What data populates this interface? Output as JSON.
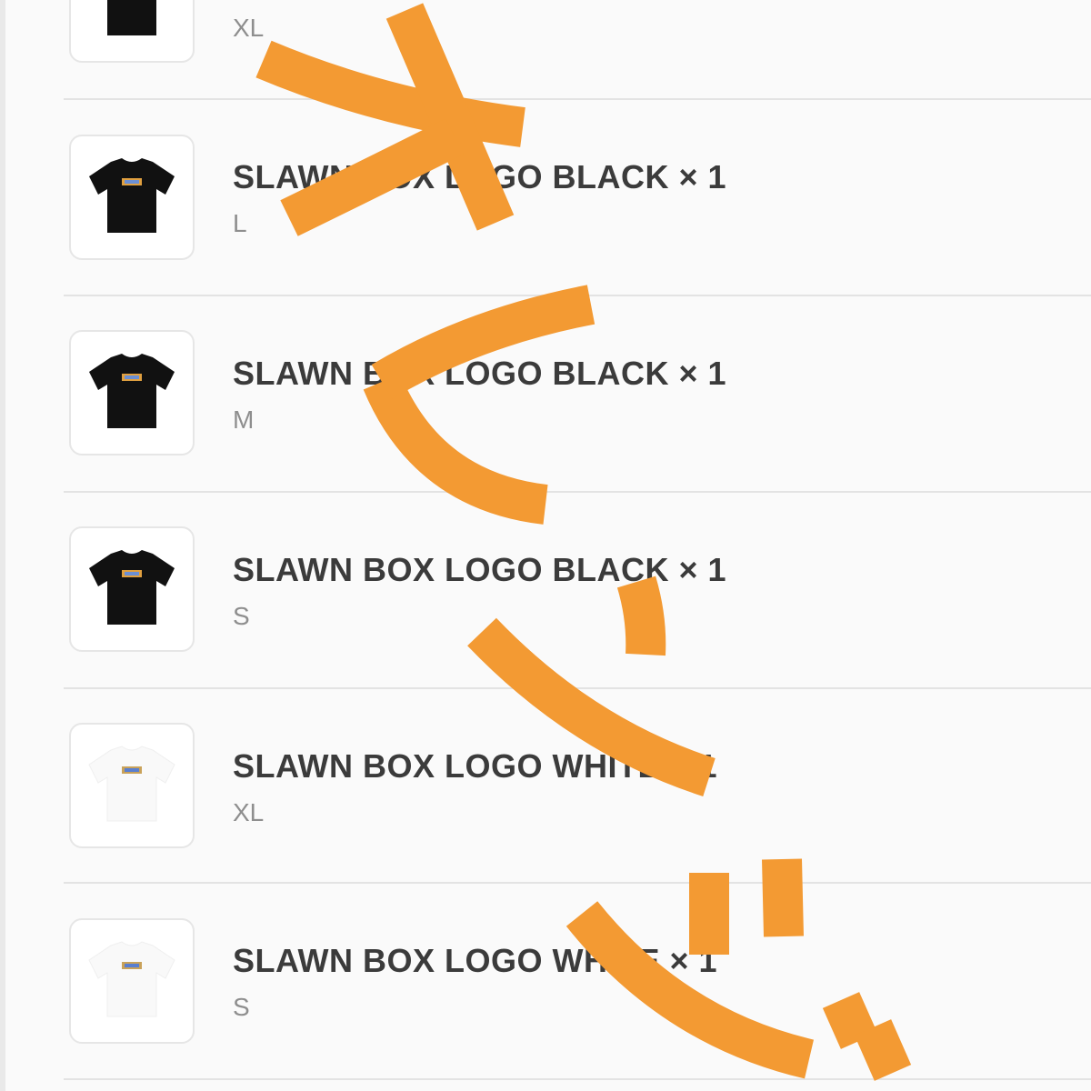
{
  "order": {
    "items": [
      {
        "title": "",
        "size": "XL",
        "shirt_color": "black",
        "icon": "tshirt-black-icon"
      },
      {
        "title": "SLAWN BOX LOGO BLACK × 1",
        "size": "L",
        "shirt_color": "black",
        "icon": "tshirt-black-icon"
      },
      {
        "title": "SLAWN BOX LOGO BLACK × 1",
        "size": "M",
        "shirt_color": "black",
        "icon": "tshirt-black-icon"
      },
      {
        "title": "SLAWN BOX LOGO BLACK × 1",
        "size": "S",
        "shirt_color": "black",
        "icon": "tshirt-black-icon"
      },
      {
        "title": "SLAWN BOX LOGO WHITE × 1",
        "size": "XL",
        "shirt_color": "white",
        "icon": "tshirt-white-icon"
      },
      {
        "title": "SLAWN BOX LOGO WHITE × 1",
        "size": "S",
        "shirt_color": "white",
        "icon": "tshirt-white-icon"
      }
    ]
  },
  "overlay": {
    "text": "オレンジ",
    "color": "#f39a33"
  },
  "colors": {
    "title": "#3b3b3b",
    "size": "#8e8e8e",
    "divider": "#e3e3e3",
    "background": "#fafafa"
  }
}
